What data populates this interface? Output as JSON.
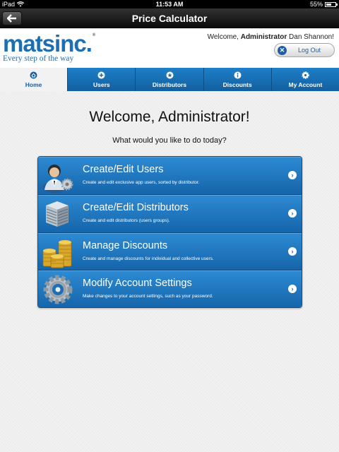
{
  "status_bar": {
    "device": "iPad",
    "time": "11:53 AM",
    "battery": "55%",
    "battery_level": 0.55
  },
  "nav": {
    "title": "Price Calculator"
  },
  "header": {
    "logo_text": "matsinc",
    "logo_dot": ".",
    "logo_reg": "®",
    "tagline": "Every step of the way",
    "welcome_prefix": "Welcome, ",
    "welcome_role": "Administrator",
    "welcome_name": " Dan Shannon!",
    "logout_label": "Log Out"
  },
  "tabs": [
    {
      "label": "Home",
      "icon": "home-icon",
      "active": true
    },
    {
      "label": "Users",
      "icon": "plus-icon",
      "active": false
    },
    {
      "label": "Distributors",
      "icon": "star-icon",
      "active": false
    },
    {
      "label": "Discounts",
      "icon": "info-icon",
      "active": false
    },
    {
      "label": "My Account",
      "icon": "gear-icon",
      "active": false
    }
  ],
  "main": {
    "heading": "Welcome, Administrator!",
    "subheading": "What would you like to do today?",
    "menu": [
      {
        "title": "Create/Edit Users",
        "description": "Create and edit exclusive app users, sorted by distributor.",
        "icon": "user-gear-icon"
      },
      {
        "title": "Create/Edit Distributors",
        "description": "Create and edit distributors (users groups).",
        "icon": "server-stack-icon"
      },
      {
        "title": "Manage Discounts",
        "description": "Create and manage discounts for individual and collective users.",
        "icon": "coin-stacks-icon"
      },
      {
        "title": "Modify Account Settings",
        "description": "Make changes to your account settings, such as your password.",
        "icon": "gear-icon"
      }
    ]
  },
  "colors": {
    "brand_blue": "#1d6fb1",
    "tab_blue": "#1a6cb0",
    "menu_blue": "#1f75bd"
  }
}
